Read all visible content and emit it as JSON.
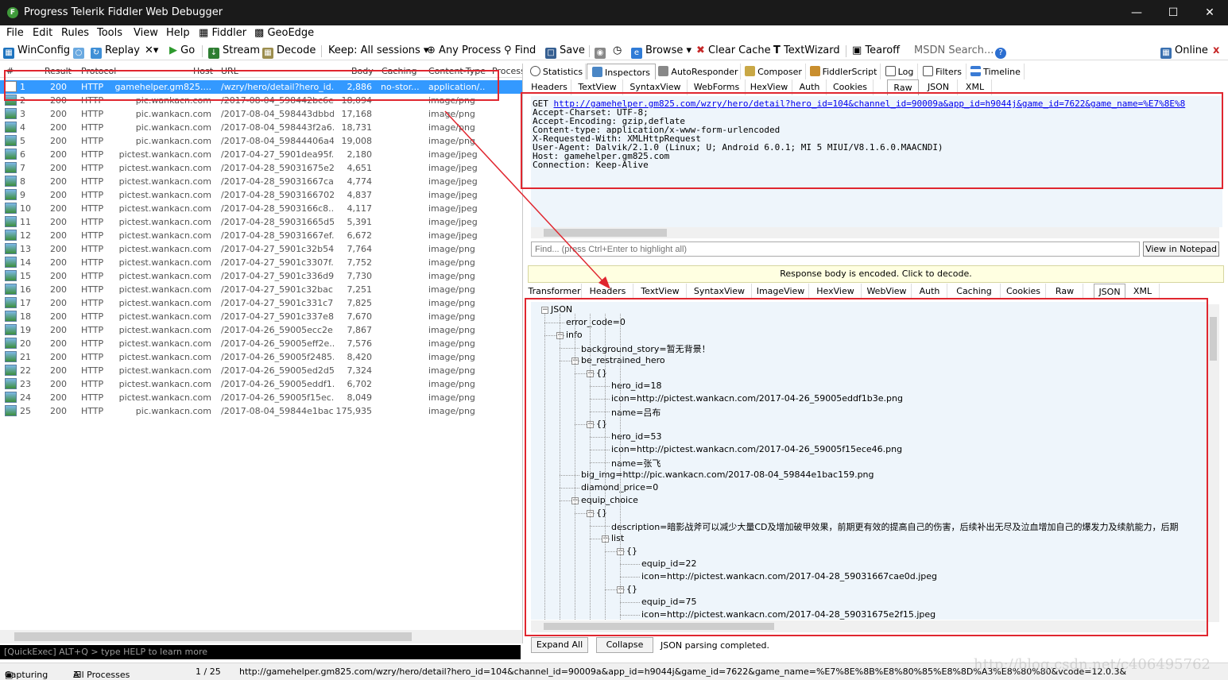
{
  "window": {
    "title": "Progress Telerik Fiddler Web Debugger",
    "app_icon": "F"
  },
  "menu": [
    "File",
    "Edit",
    "Rules",
    "Tools",
    "View",
    "Help",
    "Fiddler",
    "GeoEdge"
  ],
  "toolbar": {
    "winconfig": "WinConfig",
    "replay": "Replay",
    "remove": "✕▾",
    "go": "Go",
    "stream": "Stream",
    "decode": "Decode",
    "keep": "Keep: All sessions ▾",
    "process": "Any Process",
    "find": "Find",
    "save": "Save",
    "browse": "Browse",
    "clear_cache": "Clear Cache",
    "textwizard": "TextWizard",
    "tearoff": "Tearoff",
    "msdn": "MSDN Search...",
    "online": "Online",
    "close": "x"
  },
  "session_columns": [
    "#",
    "Result",
    "Protocol",
    "Host",
    "URL",
    "Body",
    "Caching",
    "Content-Type",
    "Process"
  ],
  "sessions": [
    {
      "num": "1",
      "result": "200",
      "protocol": "HTTP",
      "host": "gamehelper.gm825....",
      "url": "/wzry/hero/detail?hero_id...",
      "body": "2,886",
      "caching": "no-stor...",
      "ctype": "application/..."
    },
    {
      "num": "2",
      "result": "200",
      "protocol": "HTTP",
      "host": "pic.wankacn.com",
      "url": "/2017-08-04_598442bc6e...",
      "body": "18,094",
      "caching": "",
      "ctype": "image/png"
    },
    {
      "num": "3",
      "result": "200",
      "protocol": "HTTP",
      "host": "pic.wankacn.com",
      "url": "/2017-08-04_598443dbbd...",
      "body": "17,168",
      "caching": "",
      "ctype": "image/png"
    },
    {
      "num": "4",
      "result": "200",
      "protocol": "HTTP",
      "host": "pic.wankacn.com",
      "url": "/2017-08-04_598443f2a6...",
      "body": "18,731",
      "caching": "",
      "ctype": "image/png"
    },
    {
      "num": "5",
      "result": "200",
      "protocol": "HTTP",
      "host": "pic.wankacn.com",
      "url": "/2017-08-04_59844406a4...",
      "body": "19,008",
      "caching": "",
      "ctype": "image/png"
    },
    {
      "num": "6",
      "result": "200",
      "protocol": "HTTP",
      "host": "pictest.wankacn.com",
      "url": "/2017-04-27_5901dea95f...",
      "body": "2,180",
      "caching": "",
      "ctype": "image/jpeg"
    },
    {
      "num": "7",
      "result": "200",
      "protocol": "HTTP",
      "host": "pictest.wankacn.com",
      "url": "/2017-04-28_59031675e2...",
      "body": "4,651",
      "caching": "",
      "ctype": "image/jpeg"
    },
    {
      "num": "8",
      "result": "200",
      "protocol": "HTTP",
      "host": "pictest.wankacn.com",
      "url": "/2017-04-28_59031667ca...",
      "body": "4,774",
      "caching": "",
      "ctype": "image/jpeg"
    },
    {
      "num": "9",
      "result": "200",
      "protocol": "HTTP",
      "host": "pictest.wankacn.com",
      "url": "/2017-04-28_5903166702...",
      "body": "4,837",
      "caching": "",
      "ctype": "image/jpeg"
    },
    {
      "num": "10",
      "result": "200",
      "protocol": "HTTP",
      "host": "pictest.wankacn.com",
      "url": "/2017-04-28_5903166c8...",
      "body": "4,117",
      "caching": "",
      "ctype": "image/jpeg"
    },
    {
      "num": "11",
      "result": "200",
      "protocol": "HTTP",
      "host": "pictest.wankacn.com",
      "url": "/2017-04-28_59031665d5...",
      "body": "5,391",
      "caching": "",
      "ctype": "image/jpeg"
    },
    {
      "num": "12",
      "result": "200",
      "protocol": "HTTP",
      "host": "pictest.wankacn.com",
      "url": "/2017-04-28_59031667ef...",
      "body": "6,672",
      "caching": "",
      "ctype": "image/jpeg"
    },
    {
      "num": "13",
      "result": "200",
      "protocol": "HTTP",
      "host": "pictest.wankacn.com",
      "url": "/2017-04-27_5901c32b54...",
      "body": "7,764",
      "caching": "",
      "ctype": "image/png"
    },
    {
      "num": "14",
      "result": "200",
      "protocol": "HTTP",
      "host": "pictest.wankacn.com",
      "url": "/2017-04-27_5901c3307f...",
      "body": "7,752",
      "caching": "",
      "ctype": "image/png"
    },
    {
      "num": "15",
      "result": "200",
      "protocol": "HTTP",
      "host": "pictest.wankacn.com",
      "url": "/2017-04-27_5901c336d9...",
      "body": "7,730",
      "caching": "",
      "ctype": "image/png"
    },
    {
      "num": "16",
      "result": "200",
      "protocol": "HTTP",
      "host": "pictest.wankacn.com",
      "url": "/2017-04-27_5901c32bac...",
      "body": "7,251",
      "caching": "",
      "ctype": "image/png"
    },
    {
      "num": "17",
      "result": "200",
      "protocol": "HTTP",
      "host": "pictest.wankacn.com",
      "url": "/2017-04-27_5901c331c7...",
      "body": "7,825",
      "caching": "",
      "ctype": "image/png"
    },
    {
      "num": "18",
      "result": "200",
      "protocol": "HTTP",
      "host": "pictest.wankacn.com",
      "url": "/2017-04-27_5901c337e8...",
      "body": "7,670",
      "caching": "",
      "ctype": "image/png"
    },
    {
      "num": "19",
      "result": "200",
      "protocol": "HTTP",
      "host": "pictest.wankacn.com",
      "url": "/2017-04-26_59005ecc2e...",
      "body": "7,867",
      "caching": "",
      "ctype": "image/png"
    },
    {
      "num": "20",
      "result": "200",
      "protocol": "HTTP",
      "host": "pictest.wankacn.com",
      "url": "/2017-04-26_59005eff2e...",
      "body": "7,576",
      "caching": "",
      "ctype": "image/png"
    },
    {
      "num": "21",
      "result": "200",
      "protocol": "HTTP",
      "host": "pictest.wankacn.com",
      "url": "/2017-04-26_59005f2485...",
      "body": "8,420",
      "caching": "",
      "ctype": "image/png"
    },
    {
      "num": "22",
      "result": "200",
      "protocol": "HTTP",
      "host": "pictest.wankacn.com",
      "url": "/2017-04-26_59005ed2d5...",
      "body": "7,324",
      "caching": "",
      "ctype": "image/png"
    },
    {
      "num": "23",
      "result": "200",
      "protocol": "HTTP",
      "host": "pictest.wankacn.com",
      "url": "/2017-04-26_59005eddf1...",
      "body": "6,702",
      "caching": "",
      "ctype": "image/png"
    },
    {
      "num": "24",
      "result": "200",
      "protocol": "HTTP",
      "host": "pictest.wankacn.com",
      "url": "/2017-04-26_59005f15ec...",
      "body": "8,049",
      "caching": "",
      "ctype": "image/png"
    },
    {
      "num": "25",
      "result": "200",
      "protocol": "HTTP",
      "host": "pic.wankacn.com",
      "url": "/2017-08-04_59844e1bac...",
      "body": "175,935",
      "caching": "",
      "ctype": "image/png"
    }
  ],
  "top_tabs": [
    "Statistics",
    "Inspectors",
    "AutoResponder",
    "Composer",
    "FiddlerScript",
    "Log",
    "Filters",
    "Timeline"
  ],
  "request_tabs": [
    "Headers",
    "TextView",
    "SyntaxView",
    "WebForms",
    "HexView",
    "Auth",
    "Cookies",
    "Raw",
    "JSON",
    "XML"
  ],
  "request_raw": {
    "method": "GET",
    "url": "http://gamehelper.gm825.com/wzry/hero/detail?hero_id=104&channel_id=90009a&app_id=h9044j&game_id=7622&game_name=%E7%8E%8",
    "headers": [
      "Accept-Charset: UTF-8;",
      "Accept-Encoding: gzip,deflate",
      "Content-type: application/x-www-form-urlencoded",
      "X-Requested-With: XMLHttpRequest",
      "User-Agent: Dalvik/2.1.0 (Linux; U; Android 6.0.1; MI 5 MIUI/V8.1.6.0.MAACNDI)",
      "Host: gamehelper.gm825.com",
      "Connection: Keep-Alive"
    ]
  },
  "find_placeholder": "Find... (press Ctrl+Enter to highlight all)",
  "view_notepad": "View in Notepad",
  "encoded_notice": "Response body is encoded. Click to decode.",
  "response_tabs": [
    "Transformer",
    "Headers",
    "TextView",
    "SyntaxView",
    "ImageView",
    "HexView",
    "WebView",
    "Auth",
    "Caching",
    "Cookies",
    "Raw",
    "JSON",
    "XML"
  ],
  "json_tree": [
    {
      "text": "JSON",
      "depth": 0,
      "toggle": true
    },
    {
      "text": "error_code=0",
      "depth": 1,
      "toggle": false
    },
    {
      "text": "info",
      "depth": 1,
      "toggle": true
    },
    {
      "text": "background_story=暂无背景！",
      "depth": 2,
      "toggle": false
    },
    {
      "text": "be_restrained_hero",
      "depth": 2,
      "toggle": true
    },
    {
      "text": "{}",
      "depth": 3,
      "toggle": true
    },
    {
      "text": "hero_id=18",
      "depth": 4,
      "toggle": false
    },
    {
      "text": "icon=http://pictest.wankacn.com/2017-04-26_59005eddf1b3e.png",
      "depth": 4,
      "toggle": false
    },
    {
      "text": "name=吕布",
      "depth": 4,
      "toggle": false
    },
    {
      "text": "{}",
      "depth": 3,
      "toggle": true
    },
    {
      "text": "hero_id=53",
      "depth": 4,
      "toggle": false
    },
    {
      "text": "icon=http://pictest.wankacn.com/2017-04-26_59005f15ece46.png",
      "depth": 4,
      "toggle": false
    },
    {
      "text": "name=张飞",
      "depth": 4,
      "toggle": false
    },
    {
      "text": "big_img=http://pic.wankacn.com/2017-08-04_59844e1bac159.png",
      "depth": 2,
      "toggle": false
    },
    {
      "text": "diamond_price=0",
      "depth": 2,
      "toggle": false
    },
    {
      "text": "equip_choice",
      "depth": 2,
      "toggle": true
    },
    {
      "text": "{}",
      "depth": 3,
      "toggle": true
    },
    {
      "text": "description=暗影战斧可以减少大量CD及增加破甲效果，前期更有效的提高自己的伤害，后续补出无尽及泣血增加自己的爆发力及续航能力，后期",
      "depth": 4,
      "toggle": false
    },
    {
      "text": "list",
      "depth": 4,
      "toggle": true
    },
    {
      "text": "{}",
      "depth": 5,
      "toggle": true
    },
    {
      "text": "equip_id=22",
      "depth": 6,
      "toggle": false
    },
    {
      "text": "icon=http://pictest.wankacn.com/2017-04-28_59031667cae0d.jpeg",
      "depth": 6,
      "toggle": false
    },
    {
      "text": "{}",
      "depth": 5,
      "toggle": true
    },
    {
      "text": "equip_id=75",
      "depth": 6,
      "toggle": false
    },
    {
      "text": "icon=http://pictest.wankacn.com/2017-04-28_59031675e2f15.jpeg",
      "depth": 6,
      "toggle": false
    }
  ],
  "json_buttons": {
    "expand": "Expand All",
    "collapse": "Collapse",
    "status": "JSON parsing completed."
  },
  "quickexec": "[QuickExec] ALT+Q > type HELP to learn more",
  "statusbar": {
    "capturing": "Capturing",
    "processes": "All Processes",
    "count": "1 / 25",
    "url": "http://gamehelper.gm825.com/wzry/hero/detail?hero_id=104&channel_id=90009a&app_id=h9044j&game_id=7622&game_name=%E7%8E%8B%E8%80%85%E8%8D%A3%E8%80%80&vcode=12.0.3&"
  },
  "watermark": "http://blog.csdn.net/c406495762",
  "colors": {
    "selection": "#3399ff",
    "annotation": "#e0262f",
    "pane_bg": "#eef5fb"
  }
}
